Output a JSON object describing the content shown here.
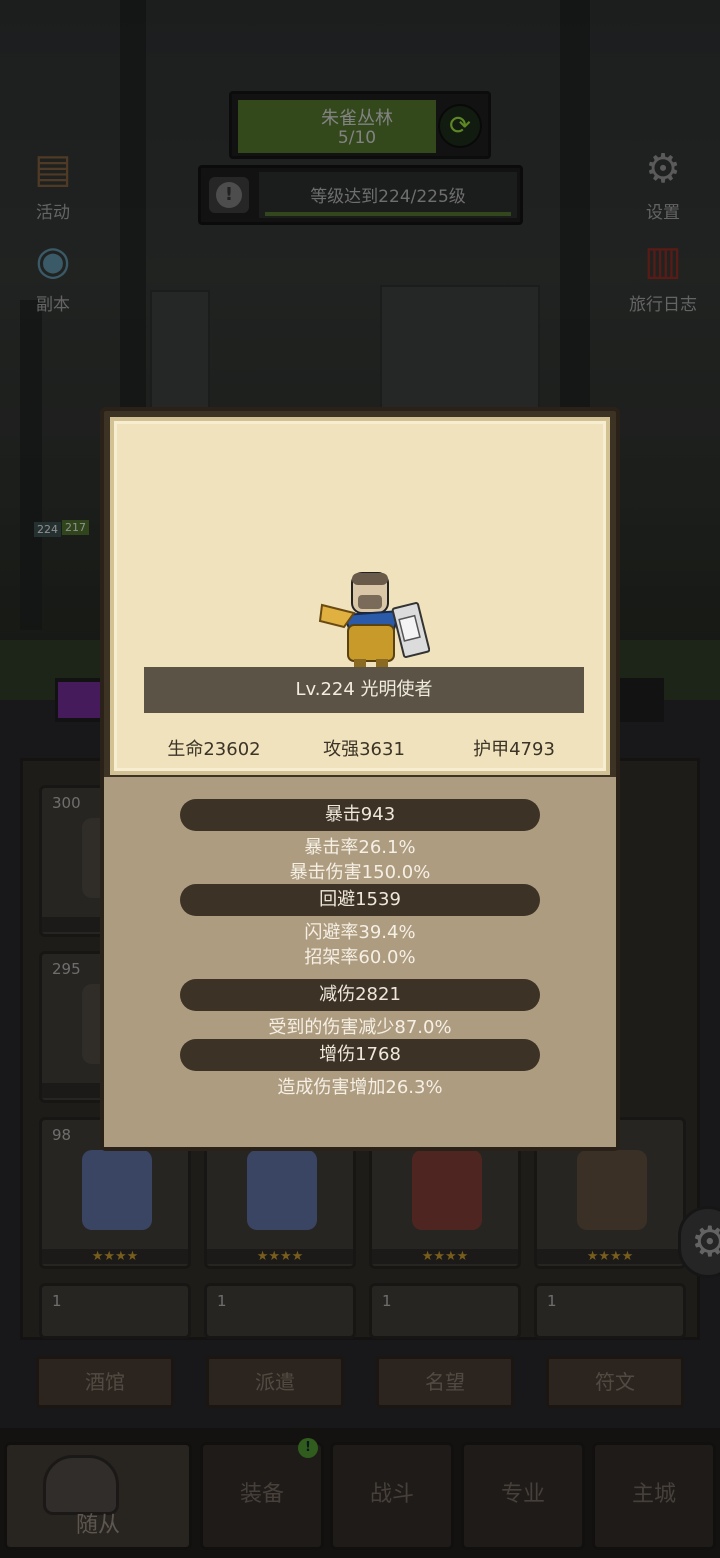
{
  "stage": {
    "name": "朱雀丛林",
    "progress": "5/10",
    "progress_fraction": 0.5
  },
  "quest": {
    "text": "等级达到224/225级",
    "alert": "!"
  },
  "side_left": [
    {
      "label": "活动",
      "icon": "scroll-board-icon"
    },
    {
      "label": "副本",
      "icon": "portal-icon"
    }
  ],
  "side_right": [
    {
      "label": "设置",
      "icon": "gear-icon"
    },
    {
      "label": "旅行日志",
      "icon": "journal-icon"
    }
  ],
  "hud": {
    "n1": "224",
    "n2": "217"
  },
  "hero_cards": [
    {
      "count": "300",
      "stars": "★★"
    },
    {
      "count": "295",
      "stars": "★★"
    },
    {
      "count": "98",
      "stars": "★★★★"
    },
    {
      "count": "",
      "stars": "★★★★"
    },
    {
      "count": "",
      "stars": "★★★★"
    },
    {
      "count": "",
      "stars": "★★★★"
    },
    {
      "count": "1",
      "stars": ""
    },
    {
      "count": "1",
      "stars": ""
    },
    {
      "count": "1",
      "stars": ""
    },
    {
      "count": "1",
      "stars": ""
    }
  ],
  "sub_tabs": [
    "酒馆",
    "派遣",
    "名望",
    "符文"
  ],
  "nav": {
    "followers": "随从",
    "equipment": "装备",
    "battle": "战斗",
    "profession": "专业",
    "main_city": "主城",
    "badge": "!"
  },
  "modal": {
    "hero_name": "Lv.224 光明使者",
    "hp": "生命23602",
    "attack": "攻强3631",
    "armor": "护甲4793",
    "crit": "暴击943",
    "crit_rate": "暴击率26.1%",
    "crit_damage": "暴击伤害150.0%",
    "dodge": "回避1539",
    "dodge_rate": "闪避率39.4%",
    "parry_rate": "招架率60.0%",
    "dmg_reduce": "减伤2821",
    "dmg_taken": "受到的伤害减少87.0%",
    "dmg_boost": "增伤1768",
    "dmg_dealt": "造成伤害增加26.3%"
  },
  "colors": {
    "parchment": "#efe2bd",
    "panel_brown": "#ad9c80",
    "pill_dark": "#3c3326",
    "stage_green": "#4f6f2a"
  }
}
